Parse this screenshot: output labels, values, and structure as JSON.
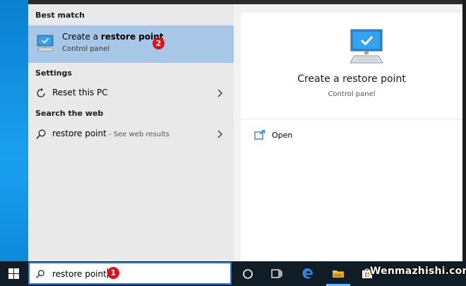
{
  "start_menu": {
    "best_match_heading": "Best match",
    "best_match": {
      "title_prefix": "Create a ",
      "title_bold": "restore point",
      "subtitle": "Control panel",
      "badge": "2"
    },
    "settings_heading": "Settings",
    "settings_items": [
      {
        "label": "Reset this PC"
      }
    ],
    "web_heading": "Search the web",
    "web_items": [
      {
        "query": "restore point",
        "hint": " - See web results"
      }
    ]
  },
  "preview": {
    "title": "Create a restore point",
    "subtitle": "Control panel",
    "actions": [
      {
        "label": "Open"
      }
    ]
  },
  "taskbar": {
    "search_value": "restore point",
    "search_badge": "1",
    "icons": [
      "windows-start-icon",
      "cortana-icon",
      "task-view-icon",
      "edge-icon",
      "file-explorer-icon",
      "store-icon"
    ]
  },
  "watermark": "Wenmazhishi.com",
  "colors": {
    "selected_row": "#a8c7e6",
    "badge_red": "#e0101a",
    "taskbar": "#101c26",
    "search_border": "#2a7fd4",
    "desktop": "#1a8fd8"
  }
}
